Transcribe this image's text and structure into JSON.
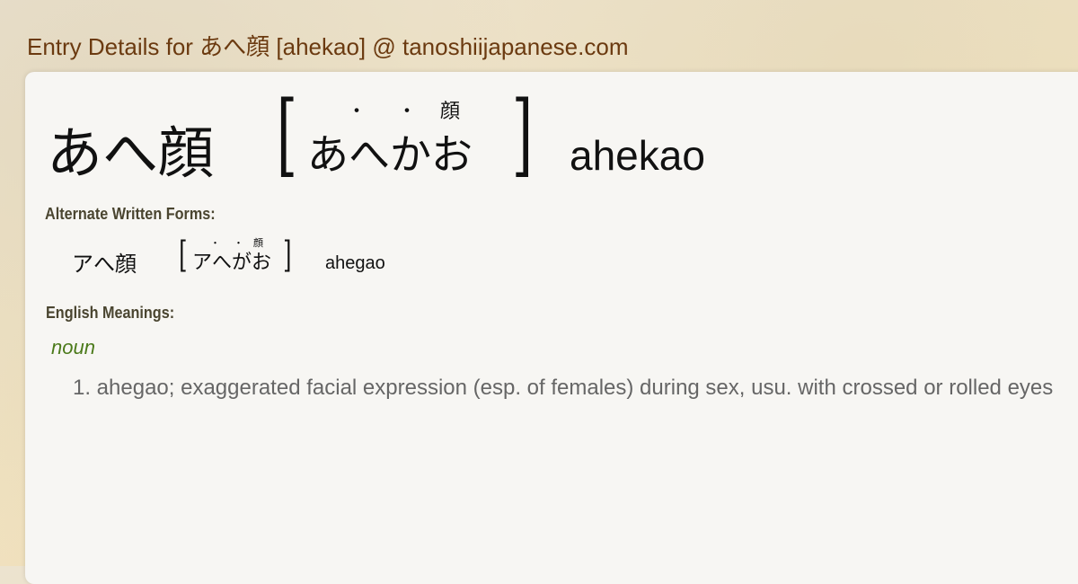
{
  "site_title": "Entry Details for あへ顔 [ahekao] @ tanoshiijapanese.com",
  "main_entry": {
    "kanji": "あへ顔",
    "reading": "あへかお",
    "ruby_dot_1": "・",
    "ruby_dot_2": "・",
    "ruby_kanji": "顔",
    "romaji": "ahekao"
  },
  "alternate_forms": {
    "label": "Alternate Written Forms:",
    "items": [
      {
        "kanji": "アへ顔",
        "reading": "アへがお",
        "ruby_dot_1": "・",
        "ruby_dot_2": "・",
        "ruby_kanji": "顔",
        "romaji": "ahegao"
      }
    ]
  },
  "meanings": {
    "label": "English Meanings:",
    "part_of_speech": "noun",
    "items": [
      "1. ahegao; exaggerated facial expression (esp. of females) during sex, usu. with crossed or rolled eyes"
    ]
  },
  "colors": {
    "title": "#6b3a10",
    "pos": "#4b7a1a",
    "meaning": "#666666",
    "card": "#f7f6f3"
  }
}
